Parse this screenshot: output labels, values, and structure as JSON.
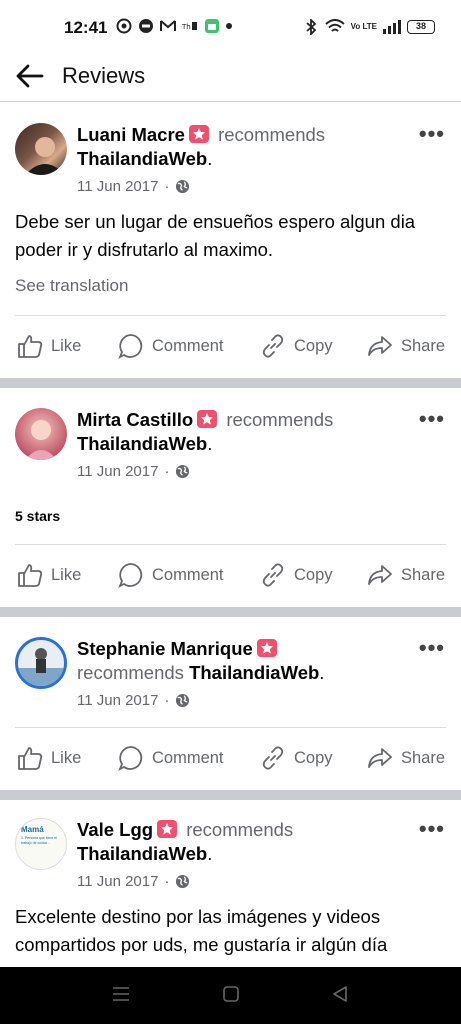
{
  "status_bar": {
    "time": "12:41",
    "battery": "38",
    "network": "Vo LTE"
  },
  "header": {
    "title": "Reviews"
  },
  "reviews": [
    {
      "name": "Luani Macre",
      "verb": "recommends",
      "page": "ThailandiaWeb",
      "date": "11 Jun 2017",
      "text": "Debe ser un lugar de  ensueños espero algun dia poder ir y disfrutarlo al maximo.",
      "translation": "See translation"
    },
    {
      "name": "Mirta Castillo",
      "verb": "recommends",
      "page": "ThailandiaWeb",
      "date": "11 Jun 2017",
      "rating_text": "5 stars"
    },
    {
      "name": "Stephanie Manrique",
      "verb": "recommends",
      "page": "ThailandiaWeb",
      "date": "11 Jun 2017"
    },
    {
      "name": "Vale Lgg",
      "verb": "recommends",
      "page": "ThailandiaWeb",
      "date": "11 Jun 2017",
      "text": "Excelente destino por las imágenes y videos compartidos por uds, me gustaría ir algún día"
    }
  ],
  "actions": {
    "like": "Like",
    "comment": "Comment",
    "copy": "Copy",
    "share": "Share"
  },
  "avatar4_text": {
    "title": "Mamá",
    "line1": "1. Persona que tiene el",
    "line2": "trabajo de cuidar..."
  },
  "colors": {
    "badge": "#f0506e",
    "secondary_text": "#65676b",
    "separator": "#c9ccd1"
  }
}
